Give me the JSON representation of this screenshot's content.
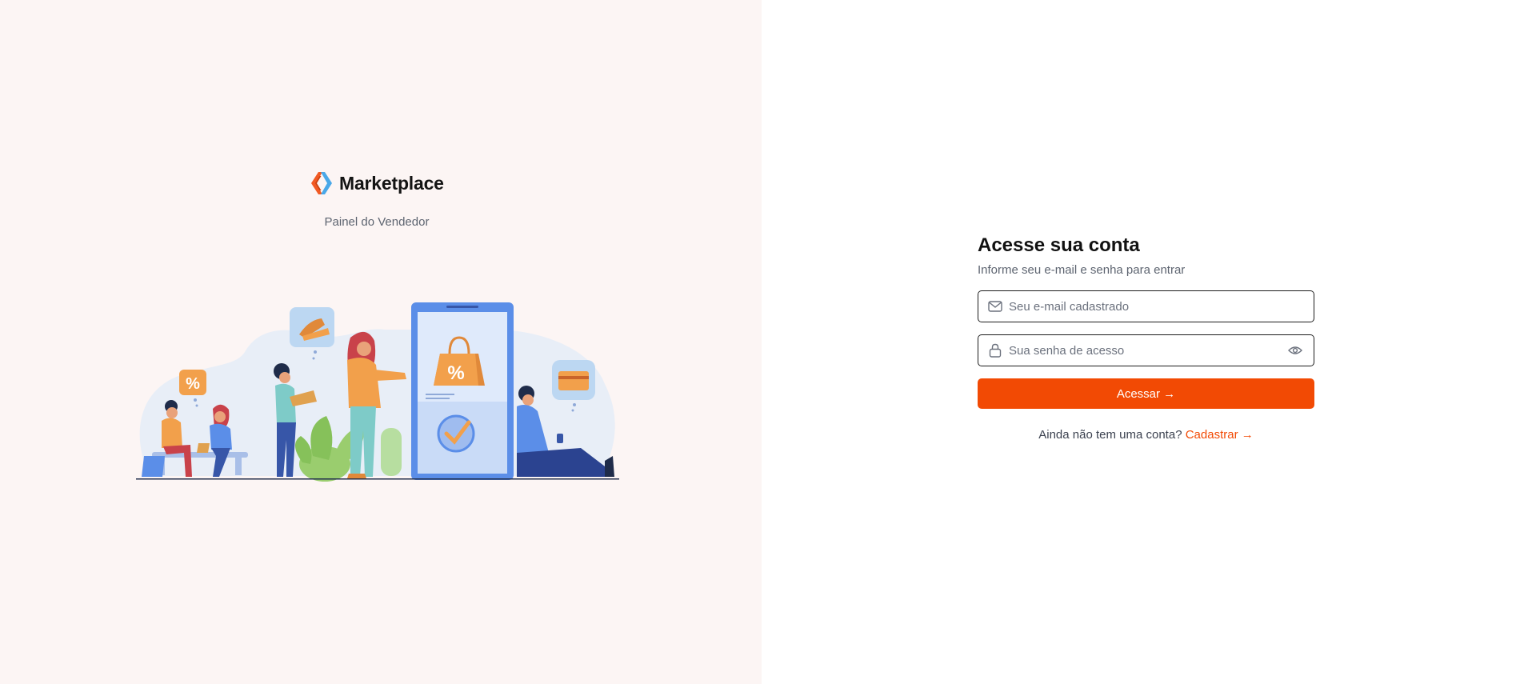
{
  "brand": {
    "name": "Marketplace",
    "subtitle": "Painel do Vendedor"
  },
  "illustration": {
    "bubble_left_icon": "%",
    "phone_bag_icon": "%"
  },
  "login": {
    "title": "Acesse sua conta",
    "subtitle": "Informe seu e-mail e senha para entrar",
    "email": {
      "placeholder": "Seu e-mail cadastrado",
      "value": "",
      "icon": "mail-icon"
    },
    "password": {
      "placeholder": "Sua senha de acesso",
      "value": "",
      "icon": "lock-icon",
      "toggle_icon": "eye-icon"
    },
    "submit_label": "Acessar →",
    "signup_prompt": "Ainda não tem uma conta?",
    "signup_link": "Cadastrar →"
  },
  "colors": {
    "accent": "#f24a04",
    "left_panel_bg": "#fcf5f4",
    "logo_orange": "#f15a24",
    "logo_blue": "#4aa8e8"
  }
}
